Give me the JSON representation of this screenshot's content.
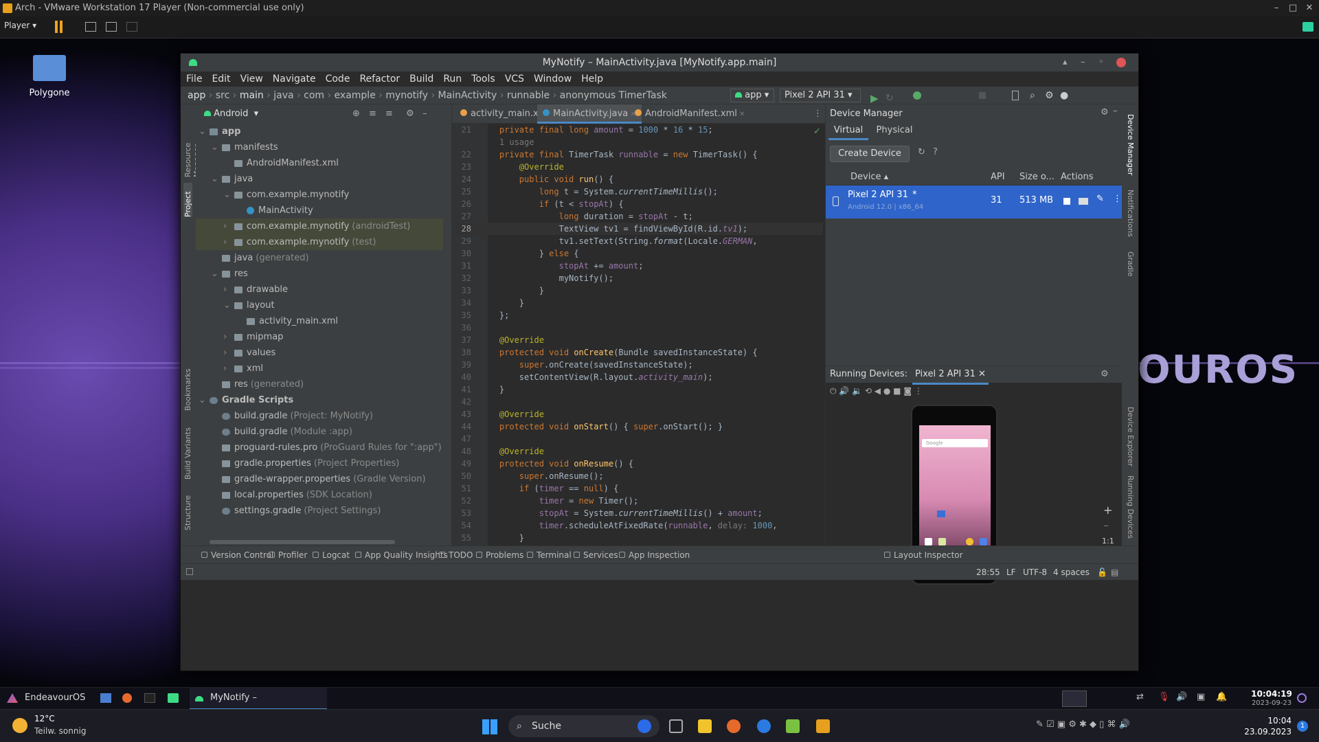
{
  "vm": {
    "title": "Arch - VMware Workstation 17 Player (Non-commercial use only)",
    "player_label": "Player"
  },
  "desktop": {
    "icon_label": "Polygone",
    "brand_text": "OUROS"
  },
  "ide": {
    "title": "MyNotify – MainActivity.java [MyNotify.app.main]",
    "menu": [
      "File",
      "Edit",
      "View",
      "Navigate",
      "Code",
      "Refactor",
      "Build",
      "Run",
      "Tools",
      "VCS",
      "Window",
      "Help"
    ],
    "breadcrumb": [
      "app",
      "src",
      "main",
      "java",
      "com",
      "example",
      "mynotify",
      "MainActivity",
      "runnable",
      "anonymous TimerTask"
    ],
    "run_config": "app",
    "device_select": "Pixel 2 API 31",
    "project_view": "Android",
    "tree": [
      {
        "label": "app",
        "indent": 0,
        "icon": "module",
        "expanded": true
      },
      {
        "label": "manifests",
        "indent": 1,
        "icon": "folder",
        "expanded": true
      },
      {
        "label": "AndroidManifest.xml",
        "indent": 2,
        "icon": "file"
      },
      {
        "label": "java",
        "indent": 1,
        "icon": "folder",
        "expanded": true
      },
      {
        "label": "com.example.mynotify",
        "indent": 2,
        "icon": "folder",
        "expanded": true
      },
      {
        "label": "MainActivity",
        "indent": 3,
        "icon": "class"
      },
      {
        "label": "com.example.mynotify",
        "suffix": "(androidTest)",
        "indent": 2,
        "icon": "folder",
        "collapsed": true,
        "hl": true
      },
      {
        "label": "com.example.mynotify",
        "suffix": "(test)",
        "indent": 2,
        "icon": "folder",
        "collapsed": true,
        "hl": true
      },
      {
        "label": "java",
        "suffix": "(generated)",
        "indent": 1,
        "icon": "folder"
      },
      {
        "label": "res",
        "indent": 1,
        "icon": "folder",
        "expanded": true
      },
      {
        "label": "drawable",
        "indent": 2,
        "icon": "folder",
        "collapsed": true
      },
      {
        "label": "layout",
        "indent": 2,
        "icon": "folder",
        "expanded": true
      },
      {
        "label": "activity_main.xml",
        "indent": 3,
        "icon": "file"
      },
      {
        "label": "mipmap",
        "indent": 2,
        "icon": "folder",
        "collapsed": true
      },
      {
        "label": "values",
        "indent": 2,
        "icon": "folder",
        "collapsed": true
      },
      {
        "label": "xml",
        "indent": 2,
        "icon": "folder",
        "collapsed": true
      },
      {
        "label": "res",
        "suffix": "(generated)",
        "indent": 1,
        "icon": "folder"
      },
      {
        "label": "Gradle Scripts",
        "indent": 0,
        "icon": "gradle",
        "expanded": true
      },
      {
        "label": "build.gradle",
        "suffix": "(Project: MyNotify)",
        "indent": 1,
        "icon": "gradle"
      },
      {
        "label": "build.gradle",
        "suffix": "(Module :app)",
        "indent": 1,
        "icon": "gradle"
      },
      {
        "label": "proguard-rules.pro",
        "suffix": "(ProGuard Rules for \":app\")",
        "indent": 1,
        "icon": "file"
      },
      {
        "label": "gradle.properties",
        "suffix": "(Project Properties)",
        "indent": 1,
        "icon": "file"
      },
      {
        "label": "gradle-wrapper.properties",
        "suffix": "(Gradle Version)",
        "indent": 1,
        "icon": "file"
      },
      {
        "label": "local.properties",
        "suffix": "(SDK Location)",
        "indent": 1,
        "icon": "file"
      },
      {
        "label": "settings.gradle",
        "suffix": "(Project Settings)",
        "indent": 1,
        "icon": "gradle"
      }
    ],
    "tabs": [
      {
        "label": "activity_main.xml",
        "active": false
      },
      {
        "label": "MainActivity.java",
        "active": true
      },
      {
        "label": "AndroidManifest.xml",
        "active": false
      }
    ],
    "left_strip": [
      "Resource Manager",
      "Project",
      "Bookmarks",
      "Build Variants",
      "Structure"
    ],
    "right_strip": [
      "Device Manager",
      "Notifications",
      "Gradle",
      "Device Explorer",
      "Running Devices"
    ],
    "code": [
      {
        "n": "21",
        "html": "    <span class='kw'>private final long</span> <span class='fld'>amount</span> = <span class='num'>1000</span> * <span class='num'>16</span> * <span class='num'>15</span>;"
      },
      {
        "n": "",
        "html": "    <span class='gr'>1 usage</span>"
      },
      {
        "n": "22",
        "html": "    <span class='kw'>private final</span> TimerTask <span class='fld'>runnable</span> = <span class='kw'>new</span> TimerTask() {"
      },
      {
        "n": "23",
        "html": "        <span class='ann'>@Override</span>"
      },
      {
        "n": "24",
        "html": "        <span class='kw'>public void</span> <span class='fn'>run</span>() {"
      },
      {
        "n": "25",
        "html": "            <span class='kw'>long</span> t = System.<span class='it'>currentTimeMillis</span>();"
      },
      {
        "n": "26",
        "html": "            <span class='kw'>if</span> (t &lt; <span class='fld'>stopAt</span>) {"
      },
      {
        "n": "27",
        "html": "                <span class='kw'>long</span> duration = <span class='fld'>stopAt</span> - t;"
      },
      {
        "n": "28",
        "html": "                TextView tv1 = findViewById(R.id.<span class='fld it'>tv1</span>);"
      },
      {
        "n": "29",
        "html": "                tv1.setText(String.<span class='it'>format</span>(Locale.<span class='fld it'>GERMAN</span>,"
      },
      {
        "n": "30",
        "html": "            } <span class='kw'>else</span> {"
      },
      {
        "n": "31",
        "html": "                <span class='fld'>stopAt</span> += <span class='fld'>amount</span>;"
      },
      {
        "n": "32",
        "html": "                myNotify();"
      },
      {
        "n": "33",
        "html": "            }"
      },
      {
        "n": "34",
        "html": "        }"
      },
      {
        "n": "35",
        "html": "    };"
      },
      {
        "n": "36",
        "html": ""
      },
      {
        "n": "37",
        "html": "    <span class='ann'>@Override</span>"
      },
      {
        "n": "38",
        "html": "    <span class='kw'>protected void</span> <span class='fn'>onCreate</span>(Bundle savedInstanceState) {"
      },
      {
        "n": "39",
        "html": "        <span class='kw'>super</span>.onCreate(savedInstanceState);"
      },
      {
        "n": "40",
        "html": "        setContentView(R.layout.<span class='fld it'>activity_main</span>);"
      },
      {
        "n": "41",
        "html": "    }"
      },
      {
        "n": "42",
        "html": ""
      },
      {
        "n": "43",
        "html": "    <span class='ann'>@Override</span>"
      },
      {
        "n": "44",
        "html": "    <span class='kw'>protected void</span> <span class='fn'>onStart</span>() { <span class='kw'>super</span>.onStart(); }"
      },
      {
        "n": "47",
        "html": ""
      },
      {
        "n": "48",
        "html": "    <span class='ann'>@Override</span>"
      },
      {
        "n": "49",
        "html": "    <span class='kw'>protected void</span> <span class='fn'>onResume</span>() {"
      },
      {
        "n": "50",
        "html": "        <span class='kw'>super</span>.onResume();"
      },
      {
        "n": "51",
        "html": "        <span class='kw'>if</span> (<span class='fld'>timer</span> == <span class='kw'>null</span>) {"
      },
      {
        "n": "52",
        "html": "            <span class='fld'>timer</span> = <span class='kw'>new</span> Timer();"
      },
      {
        "n": "53",
        "html": "            <span class='fld'>stopAt</span> = System.<span class='it'>currentTimeMillis</span>() + <span class='fld'>amount</span>;"
      },
      {
        "n": "54",
        "html": "            <span class='fld'>timer</span>.scheduleAtFixedRate(<span class='fld'>runnable</span>, <span class='gr'>delay:</span> <span class='num'>1000</span>,"
      },
      {
        "n": "55",
        "html": "        }"
      }
    ],
    "device_manager": {
      "title": "Device Manager",
      "tabs": [
        "Virtual",
        "Physical"
      ],
      "create_label": "Create Device",
      "columns": [
        "Device",
        "API",
        "Size o...",
        "Actions"
      ],
      "device": {
        "name": "Pixel 2 API 31",
        "sub": "Android 12.0 | x86_64",
        "api": "31",
        "size": "513 MB"
      }
    },
    "running": {
      "label": "Running Devices:",
      "tab": "Pixel 2 API 31",
      "zoom_reset": "1:1",
      "search_hint": "Google"
    },
    "bottom_tools": [
      "Version Control",
      "Profiler",
      "Logcat",
      "App Quality Insights",
      "TODO",
      "Problems",
      "Terminal",
      "Services",
      "App Inspection",
      "Layout Inspector"
    ],
    "status": {
      "position": "28:55",
      "line_sep": "LF",
      "encoding": "UTF-8",
      "indent": "4 spaces"
    }
  },
  "taskbar_top": {
    "start_label": "EndeavourOS",
    "active_window": "MyNotify – MainActivity.j...",
    "time": "10:04:19",
    "date": "2023-09-23"
  },
  "taskbar_bottom": {
    "weather_temp": "12°C",
    "weather_desc": "Teilw. sonnig",
    "search_label": "Suche",
    "time": "10:04",
    "date": "23.09.2023",
    "notif_count": "1"
  }
}
